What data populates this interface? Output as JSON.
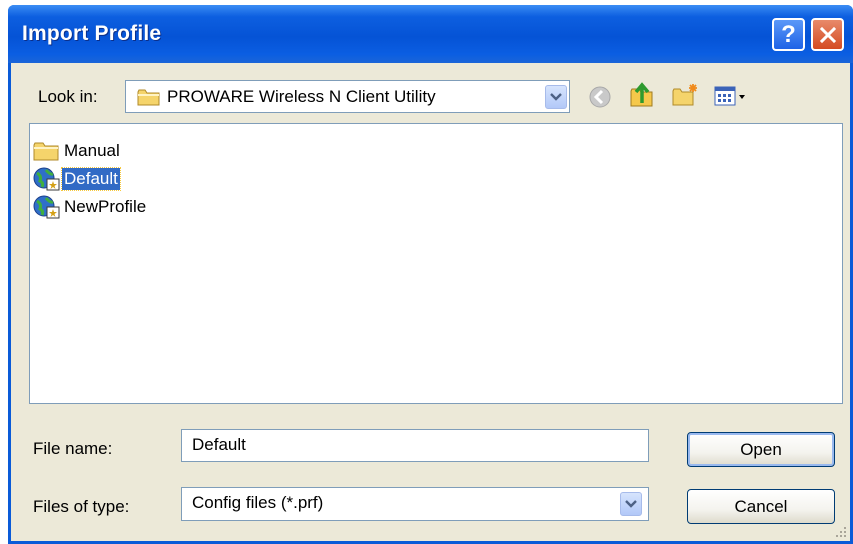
{
  "window": {
    "title": "Import Profile"
  },
  "toolbar": {
    "look_in_label": "Look in:",
    "look_in_value": "PROWARE Wireless N Client Utility"
  },
  "files": [
    {
      "name": "Manual",
      "type": "folder"
    },
    {
      "name": "Default",
      "type": "profile",
      "selected": true
    },
    {
      "name": "NewProfile",
      "type": "profile"
    }
  ],
  "form": {
    "file_name_label": "File name:",
    "file_name_value": "Default",
    "file_type_label": "Files of type:",
    "file_type_value": "Config files (*.prf)"
  },
  "buttons": {
    "open": "Open",
    "cancel": "Cancel"
  },
  "colors": {
    "titlebar": "#0553d6",
    "dialog_bg": "#ece9d8",
    "selection": "#316ac5",
    "close": "#d44a22"
  }
}
